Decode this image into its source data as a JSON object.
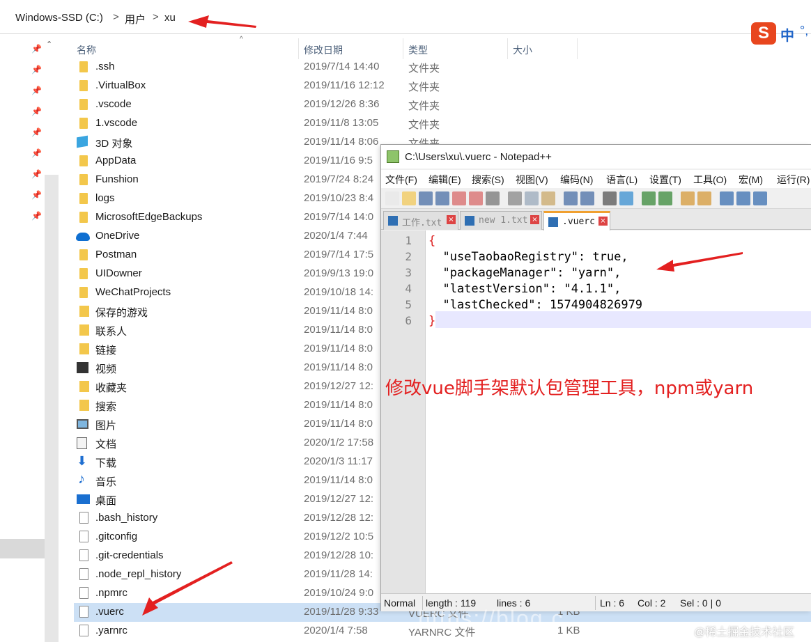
{
  "explorer": {
    "breadcrumb": [
      "Windows-SSD (C:)",
      "用户",
      "xu"
    ],
    "breadcrumb_separator": ">",
    "columns": {
      "name": "名称",
      "modified": "修改日期",
      "type": "类型",
      "size": "大小"
    },
    "rows": [
      {
        "name": ".ssh",
        "date": "2019/7/14 14:40",
        "type": "文件夹",
        "icon": "folder-icon"
      },
      {
        "name": ".VirtualBox",
        "date": "2019/11/16 12:12",
        "type": "文件夹",
        "icon": "folder-icon"
      },
      {
        "name": ".vscode",
        "date": "2019/12/26 8:36",
        "type": "文件夹",
        "icon": "folder-icon"
      },
      {
        "name": "1.vscode",
        "date": "2019/11/8 13:05",
        "type": "文件夹",
        "icon": "folder-icon"
      },
      {
        "name": "3D 对象",
        "date": "2019/11/14 8:06",
        "type": "文件夹",
        "icon": "3d-objects-icon"
      },
      {
        "name": "AppData",
        "date": "2019/11/16 9:5",
        "type": "",
        "icon": "folder-icon"
      },
      {
        "name": "Funshion",
        "date": "2019/7/24 8:24",
        "type": "",
        "icon": "folder-icon"
      },
      {
        "name": "logs",
        "date": "2019/10/23 8:4",
        "type": "",
        "icon": "folder-icon"
      },
      {
        "name": "MicrosoftEdgeBackups",
        "date": "2019/7/14 14:0",
        "type": "",
        "icon": "folder-icon"
      },
      {
        "name": "OneDrive",
        "date": "2020/1/4 7:44",
        "type": "",
        "icon": "onedrive-icon"
      },
      {
        "name": "Postman",
        "date": "2019/7/14 17:5",
        "type": "",
        "icon": "folder-icon"
      },
      {
        "name": "UIDowner",
        "date": "2019/9/13 19:0",
        "type": "",
        "icon": "folder-icon"
      },
      {
        "name": "WeChatProjects",
        "date": "2019/10/18 14:",
        "type": "",
        "icon": "folder-icon"
      },
      {
        "name": "保存的游戏",
        "date": "2019/11/14 8:0",
        "type": "",
        "icon": "saved-games-icon"
      },
      {
        "name": "联系人",
        "date": "2019/11/14 8:0",
        "type": "",
        "icon": "contacts-icon"
      },
      {
        "name": "链接",
        "date": "2019/11/14 8:0",
        "type": "",
        "icon": "links-icon"
      },
      {
        "name": "视频",
        "date": "2019/11/14 8:0",
        "type": "",
        "icon": "videos-icon"
      },
      {
        "name": "收藏夹",
        "date": "2019/12/27 12:",
        "type": "",
        "icon": "favorites-icon"
      },
      {
        "name": "搜索",
        "date": "2019/11/14 8:0",
        "type": "",
        "icon": "searches-icon"
      },
      {
        "name": "图片",
        "date": "2019/11/14 8:0",
        "type": "",
        "icon": "pictures-icon"
      },
      {
        "name": "文档",
        "date": "2020/1/2 17:58",
        "type": "",
        "icon": "documents-icon"
      },
      {
        "name": "下载",
        "date": "2020/1/3 11:17",
        "type": "",
        "icon": "downloads-icon"
      },
      {
        "name": "音乐",
        "date": "2019/11/14 8:0",
        "type": "",
        "icon": "music-icon"
      },
      {
        "name": "桌面",
        "date": "2019/12/27 12:",
        "type": "",
        "icon": "desktop-icon"
      },
      {
        "name": ".bash_history",
        "date": "2019/12/28 12:",
        "type": "",
        "icon": "file-icon"
      },
      {
        "name": ".gitconfig",
        "date": "2019/12/2 10:5",
        "type": "",
        "icon": "file-icon"
      },
      {
        "name": ".git-credentials",
        "date": "2019/12/28 10:",
        "type": "",
        "icon": "file-icon"
      },
      {
        "name": ".node_repl_history",
        "date": "2019/11/28 14:",
        "type": "",
        "icon": "file-icon"
      },
      {
        "name": ".npmrc",
        "date": "2019/10/24 9:0",
        "type": "",
        "icon": "file-icon"
      },
      {
        "name": ".vuerc",
        "date": "2019/11/28 9:33",
        "type": "VUERC 文件",
        "size": "1 KB",
        "icon": "file-icon",
        "selected": true
      },
      {
        "name": ".yarnrc",
        "date": "2020/1/4 7:58",
        "type": "YARNRC 文件",
        "size": "1 KB",
        "icon": "file-icon"
      }
    ]
  },
  "ime": {
    "logo": "S",
    "mode": "中",
    "punct": "°,"
  },
  "notepad": {
    "title": "C:\\Users\\xu\\.vuerc - Notepad++",
    "menu": [
      "文件(F)",
      "编辑(E)",
      "搜索(S)",
      "视图(V)",
      "编码(N)",
      "语言(L)",
      "设置(T)",
      "工具(O)",
      "宏(M)",
      "运行(R)"
    ],
    "tabs": [
      {
        "label": "工作.txt",
        "active": false
      },
      {
        "label": "new 1.txt",
        "active": false
      },
      {
        "label": ".vuerc",
        "active": true
      }
    ],
    "tab_close": "×",
    "lines": [
      {
        "num": "1",
        "text": "{"
      },
      {
        "num": "2",
        "text": "  \"useTaobaoRegistry\": true,"
      },
      {
        "num": "3",
        "text": "  \"packageManager\": \"yarn\","
      },
      {
        "num": "4",
        "text": "  \"latestVersion\": \"4.1.1\","
      },
      {
        "num": "5",
        "text": "  \"lastChecked\": 1574904826979"
      },
      {
        "num": "6",
        "text": "}"
      }
    ],
    "annotation": "修改vue脚手架默认包管理工具，npm或yarn",
    "status": {
      "mode": "Normal",
      "length": "length : 119",
      "lines": "lines : 6",
      "ln": "Ln : 6",
      "col": "Col : 2",
      "sel": "Sel : 0 | 0"
    }
  },
  "watermark": "@稀土掘金技术社区",
  "url_watermark": "https://blog.c",
  "colors": {
    "annotation_red": "#e32020",
    "selection_blue": "#cce0f5",
    "folder_yellow": "#f3c74b"
  }
}
